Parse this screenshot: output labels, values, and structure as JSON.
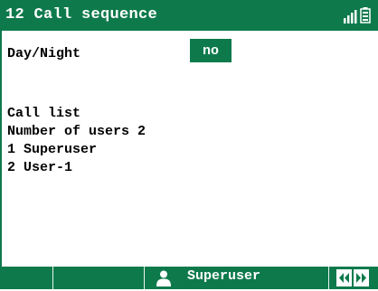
{
  "header": {
    "title": "12 Call sequence",
    "signal_icon": "signal-bars-icon",
    "battery_icon": "battery-icon"
  },
  "settings": {
    "day_night_label": "Day/Night",
    "day_night_value": "no"
  },
  "call_list": {
    "heading": "Call list",
    "count_text": "Number of users 2",
    "entries": [
      "1 Superuser",
      "2 User-1"
    ]
  },
  "softkeys": {
    "current_user": "Superuser",
    "user_icon": "user-icon",
    "prev_icon": "double-chevron-left-icon",
    "next_icon": "double-chevron-right-icon"
  },
  "colors": {
    "accent": "#0e7a4c",
    "background": "#ffffff",
    "text": "#000000"
  }
}
